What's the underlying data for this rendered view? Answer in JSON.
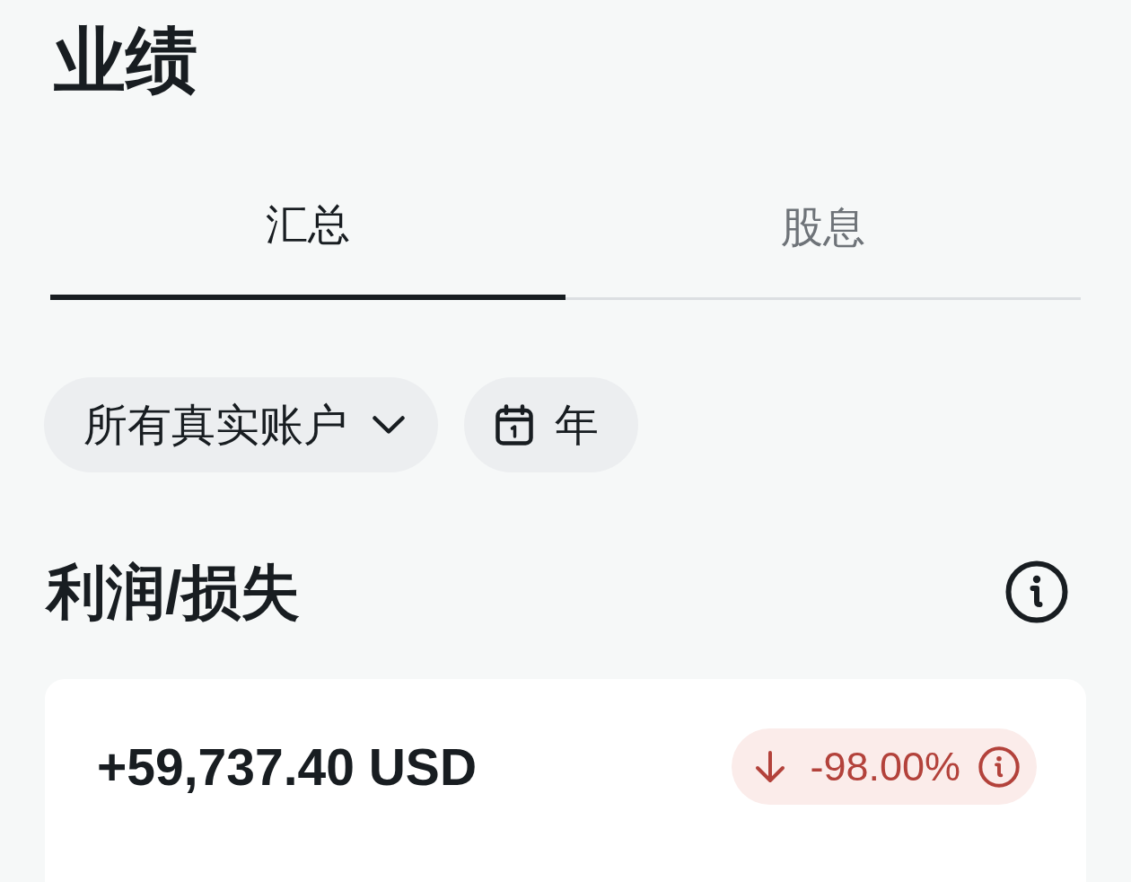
{
  "page": {
    "title": "业绩"
  },
  "tabs": [
    {
      "label": "汇总",
      "selected": true
    },
    {
      "label": "股息",
      "selected": false
    }
  ],
  "filters": [
    {
      "kind": "dropdown",
      "label": "所有真实账户"
    },
    {
      "kind": "date",
      "label": "年"
    }
  ],
  "profit_loss": {
    "heading": "利润/损失",
    "amount": "+59,737.40 USD",
    "change": {
      "negative": true,
      "value": "-98.00%"
    }
  }
}
